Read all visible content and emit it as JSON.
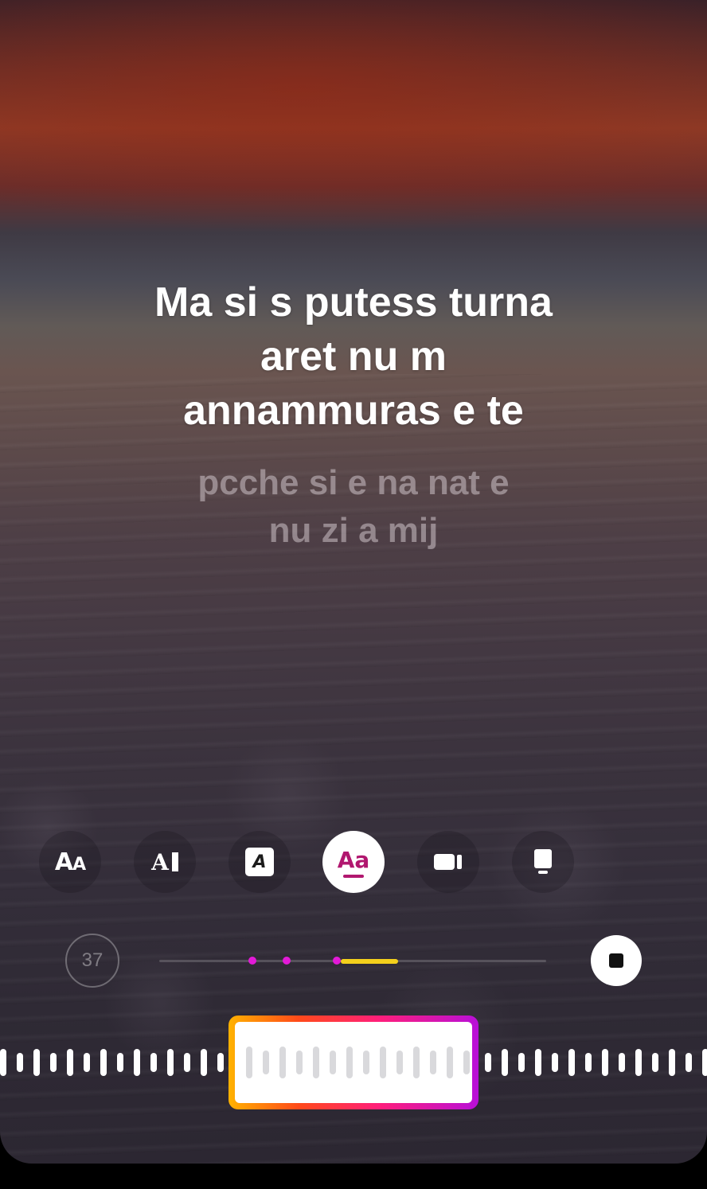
{
  "lyrics": {
    "current": [
      "Ma si s putess turna",
      "aret nu m",
      "annammuras e te"
    ],
    "next": [
      "pcche si e na nat e",
      "nu zi a mij"
    ]
  },
  "style_options": [
    {
      "name": "classic-text-style",
      "icon": "AA"
    },
    {
      "name": "typewriter-text-style",
      "icon": "AI"
    },
    {
      "name": "boxed-text-style",
      "icon": "A"
    },
    {
      "name": "highlight-text-style",
      "icon": "Aa",
      "selected": true
    },
    {
      "name": "video-style",
      "icon": "video-card-icon"
    },
    {
      "name": "card-style",
      "icon": "card-icon"
    }
  ],
  "timer": {
    "value": "37"
  },
  "playback": {
    "progress_segment_color": "#f4d01c",
    "marker_color": "#e21ad7"
  },
  "colors": {
    "selected_style_accent": "#b1176f"
  }
}
